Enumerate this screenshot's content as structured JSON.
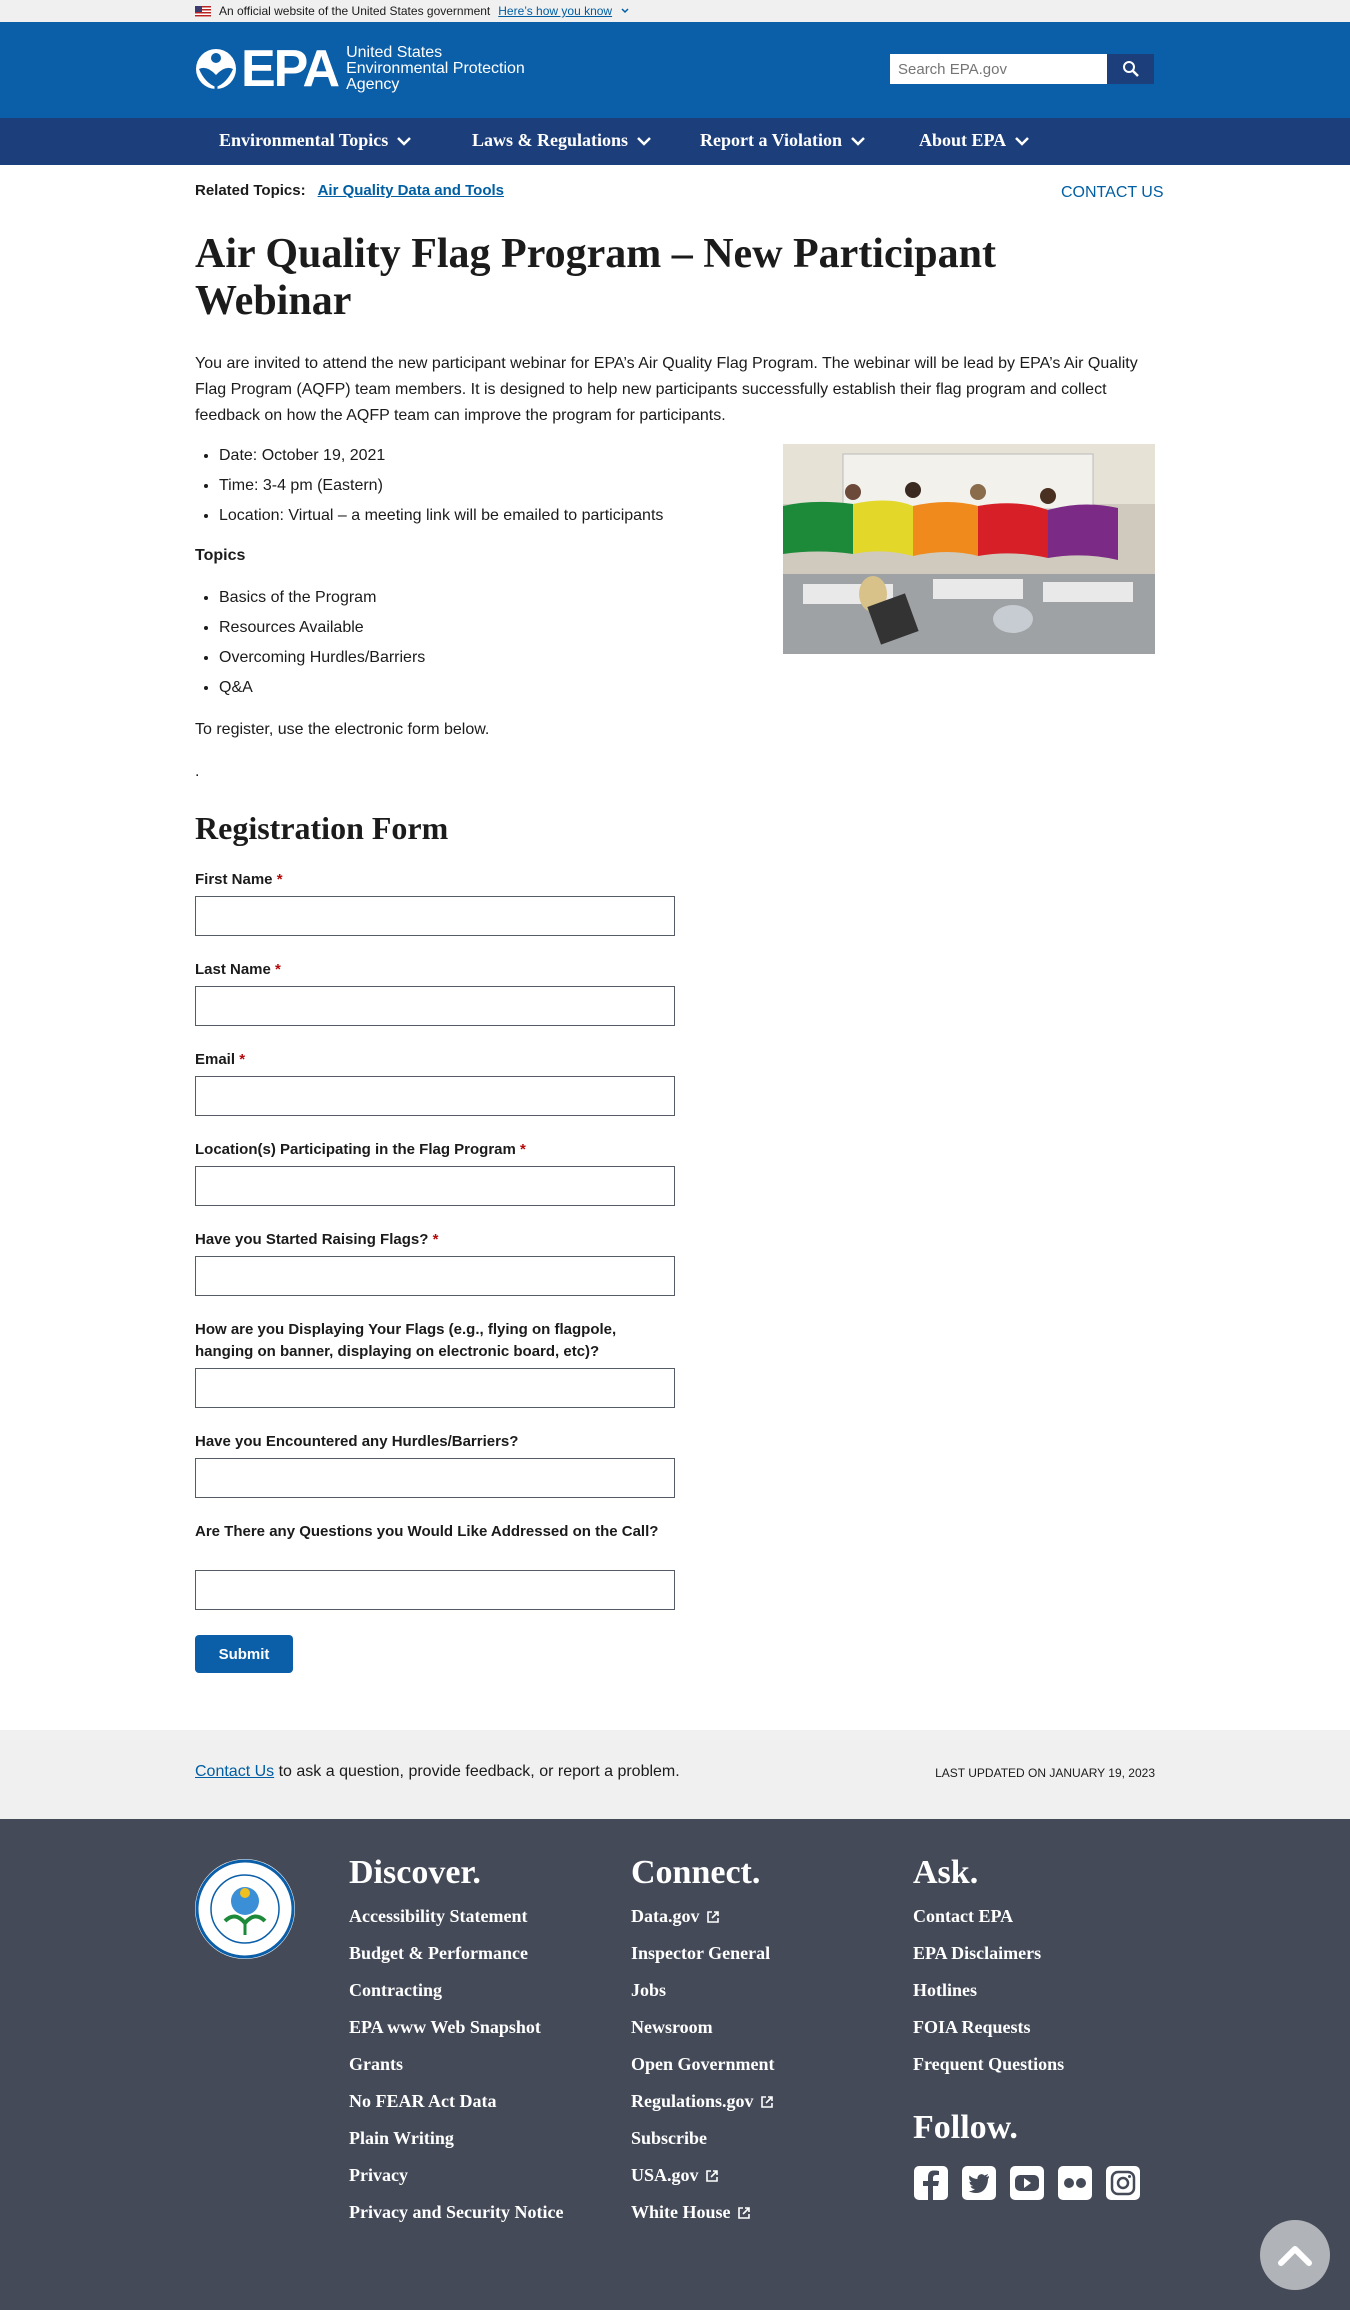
{
  "gov_banner": {
    "text": "An official website of the United States government",
    "link": "Here’s how you know"
  },
  "header": {
    "logo_text": "EPA",
    "agency_line1": "United States",
    "agency_line2": "Environmental Protection",
    "agency_line3": "Agency",
    "search_placeholder": "Search EPA.gov"
  },
  "nav": {
    "items": [
      {
        "label": "Environmental Topics"
      },
      {
        "label": "Laws & Regulations"
      },
      {
        "label": "Report a Violation"
      },
      {
        "label": "About EPA"
      }
    ]
  },
  "related": {
    "label": "Related Topics:",
    "link": "Air Quality Data and Tools",
    "contact": "CONTACT US"
  },
  "page": {
    "title": "Air Quality Flag Program – New Participant Webinar",
    "intro": "You are invited to attend the new participant webinar for EPA’s Air Quality Flag Program. The webinar will be lead by EPA’s Air Quality Flag Program (AQFP) team members. It is designed to help new participants successfully establish their flag program and collect feedback on how the AQFP team can improve the program for participants.",
    "details": [
      "Date: October 19, 2021",
      "Time: 3-4 pm (Eastern)",
      "Location: Virtual – a meeting link will be emailed to participants"
    ],
    "topics_heading": "Topics",
    "topics": [
      "Basics of the Program",
      "Resources Available",
      "Overcoming Hurdles/Barriers",
      "Q&A"
    ],
    "register_text": "To register, use the electronic form below.",
    "dot": "."
  },
  "form": {
    "heading": "Registration Form",
    "fields": [
      {
        "label": "First Name",
        "required": "*"
      },
      {
        "label": "Last Name",
        "required": "*"
      },
      {
        "label": "Email",
        "required": "*"
      },
      {
        "label": "Location(s) Participating in the Flag Program",
        "required": "*"
      },
      {
        "label": "Have you Started Raising Flags?",
        "required": "*"
      },
      {
        "label": "How are you Displaying Your Flags (e.g., flying on flagpole, hanging on banner, displaying on electronic board, etc)?",
        "required": ""
      },
      {
        "label": "Have you Encountered any Hurdles/Barriers?",
        "required": ""
      },
      {
        "label": "Are There any Questions you Would Like Addressed on the Call?",
        "required": ""
      }
    ],
    "submit": "Submit"
  },
  "footer_band": {
    "contact_link": "Contact Us",
    "contact_rest": " to ask a question, provide feedback, or report a problem.",
    "last_updated": "LAST UPDATED ON JANUARY 19, 2023"
  },
  "footer": {
    "discover": {
      "heading": "Discover.",
      "links": [
        "Accessibility Statement",
        "Budget & Performance",
        "Contracting",
        "EPA www Web Snapshot",
        "Grants",
        "No FEAR Act Data",
        "Plain Writing",
        "Privacy",
        "Privacy and Security Notice"
      ]
    },
    "connect": {
      "heading": "Connect.",
      "links": [
        "Data.gov",
        "Inspector General",
        "Jobs",
        "Newsroom",
        "Open Government",
        "Regulations.gov",
        "Subscribe",
        "USA.gov",
        "White House"
      ]
    },
    "ask": {
      "heading": "Ask.",
      "links": [
        "Contact EPA",
        "EPA Disclaimers",
        "Hotlines",
        "FOIA Requests",
        "Frequent Questions"
      ]
    },
    "follow": {
      "heading": "Follow.",
      "icons": [
        "facebook-icon",
        "twitter-icon",
        "youtube-icon",
        "flickr-icon",
        "instagram-icon"
      ]
    }
  },
  "colors": {
    "header_blue": "#0b5ea8",
    "nav_navy": "#1c3f7b",
    "footer_gray": "#444a57",
    "link_blue": "#005ea2"
  }
}
